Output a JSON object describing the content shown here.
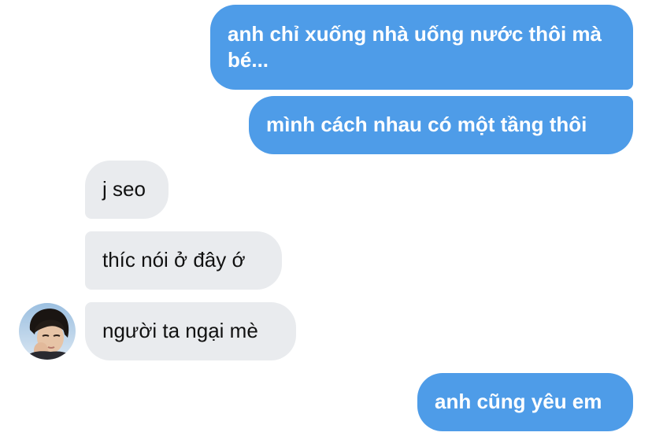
{
  "conversation": {
    "messages": [
      {
        "direction": "sent",
        "text": "anh chỉ xuống nhà uống nước thôi mà bé..."
      },
      {
        "direction": "sent",
        "text": "mình cách nhau có một tầng thôi"
      },
      {
        "direction": "received",
        "text": "j seo"
      },
      {
        "direction": "received",
        "text": "thíc nói ở đây ớ"
      },
      {
        "direction": "received",
        "text": "người ta ngại mè"
      },
      {
        "direction": "sent",
        "text": "anh cũng yêu em"
      }
    ],
    "contact_avatar": {
      "icon": "contact-avatar-photo"
    }
  },
  "colors": {
    "sent_bubble": "#4e9ce8",
    "received_bubble": "#e9ebee",
    "sent_text": "#ffffff",
    "received_text": "#111111",
    "background": "#ffffff"
  }
}
